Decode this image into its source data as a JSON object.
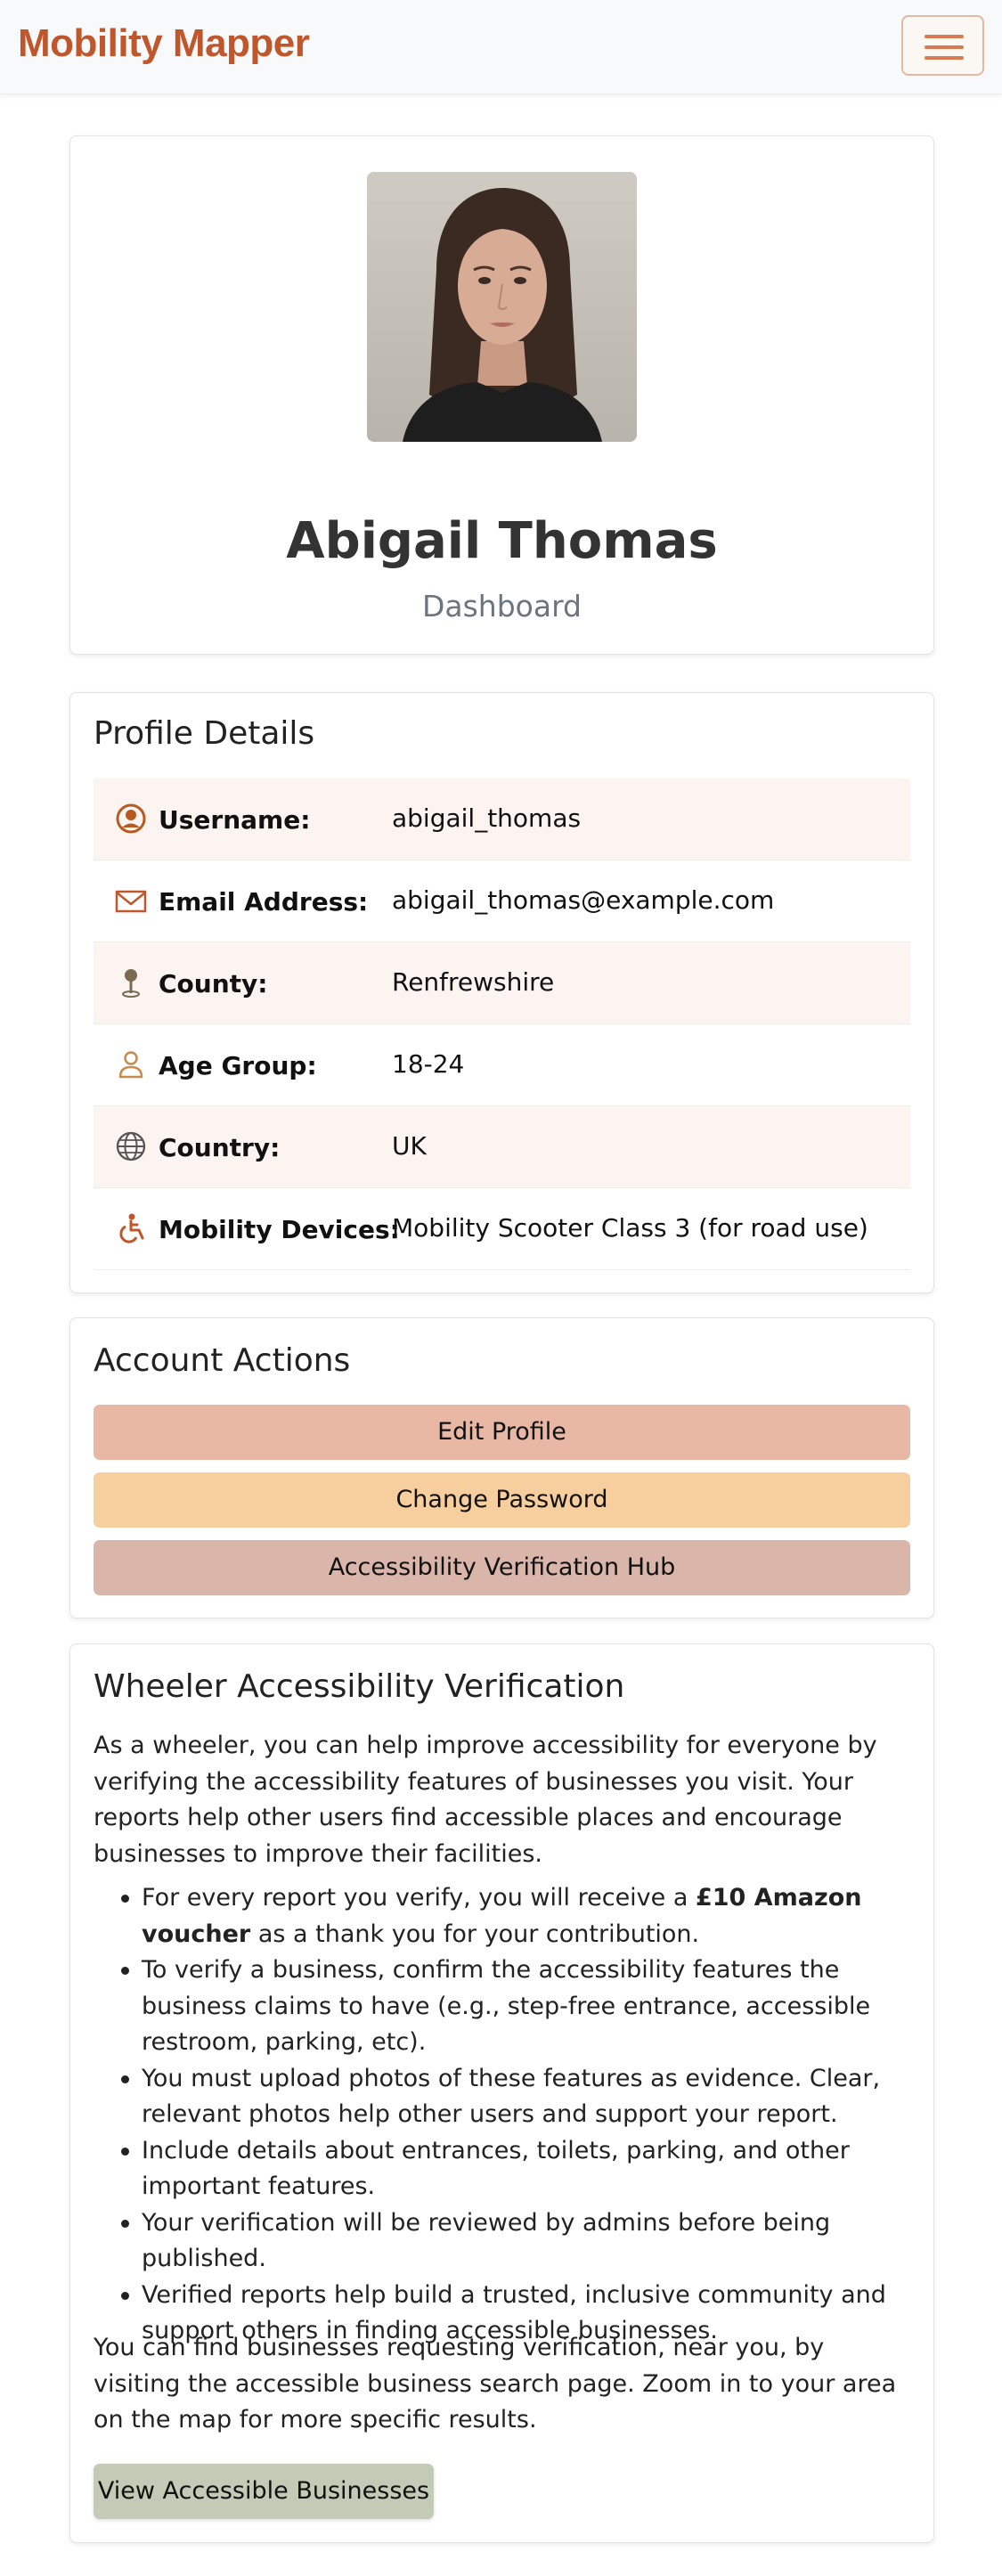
{
  "app": {
    "brand": "Mobility Mapper"
  },
  "header": {
    "name": "Abigail Thomas",
    "subtitle": "Dashboard"
  },
  "profile": {
    "title": "Profile Details",
    "rows": [
      {
        "icon": "user-circle-icon",
        "label": "Username:",
        "value": "abigail_thomas"
      },
      {
        "icon": "envelope-icon",
        "label": "Email Address:",
        "value": "abigail_thomas@example.com"
      },
      {
        "icon": "map-pin-icon",
        "label": "County:",
        "value": "Renfrewshire"
      },
      {
        "icon": "person-icon",
        "label": "Age Group:",
        "value": "18-24"
      },
      {
        "icon": "globe-icon",
        "label": "Country:",
        "value": "UK"
      },
      {
        "icon": "wheelchair-icon",
        "label": "Mobility Devices:",
        "value": "Mobility Scooter Class 3 (for road use)"
      }
    ]
  },
  "actions": {
    "title": "Account Actions",
    "edit_profile": "Edit Profile",
    "change_password": "Change Password",
    "verification_hub": "Accessibility Verification Hub"
  },
  "verification": {
    "title": "Wheeler Accessibility Verification",
    "intro": "As a wheeler, you can help improve accessibility for everyone by verifying the accessibility features of businesses you visit. Your reports help other users find accessible places and encourage businesses to improve their facilities.",
    "bullet1_pre": "For every report you verify, you will receive a ",
    "bullet1_bold": "£10 Amazon voucher",
    "bullet1_post": " as a thank you for your contribution.",
    "bullet2": "To verify a business, confirm the accessibility features the business claims to have (e.g., step-free entrance, accessible restroom, parking, etc).",
    "bullet3": "You must upload photos of these features as evidence. Clear, relevant photos help other users and support your report.",
    "bullet4": "Include details about entrances, toilets, parking, and other important features.",
    "bullet5": "Your verification will be reviewed by admins before being published.",
    "bullet6": "Verified reports help build a trusted, inclusive community and support others in finding accessible businesses.",
    "outro": "You can find businesses requesting verification, near you, by visiting the accessible business search page. Zoom in to your area on the map for more specific results.",
    "button": "View Accessible Businesses"
  },
  "colors": {
    "brand": "#c0562b",
    "edit_button": "#e9b8a4",
    "password_button": "#f7cf9f",
    "hub_button": "#d9b5aa",
    "view_button": "#c3cab5",
    "row_stripe": "#fbf4f1"
  }
}
